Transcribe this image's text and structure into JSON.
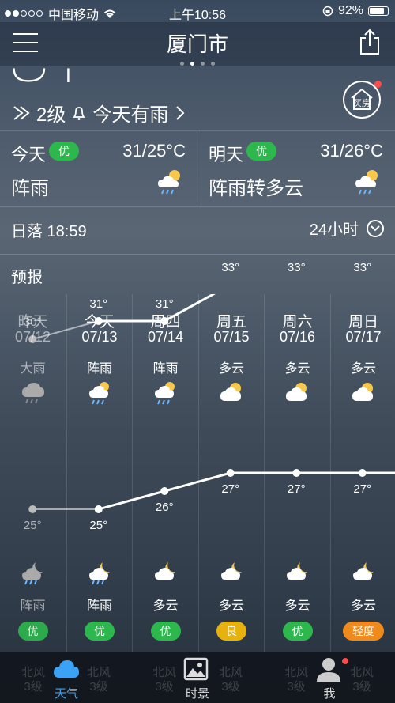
{
  "status_bar": {
    "signal_text": "●●○○○ 中国移动",
    "carrier": "中国移动",
    "time": "上午10:56",
    "battery": "92%"
  },
  "header": {
    "city": "厦门市",
    "page_count": 4,
    "active_page": 1
  },
  "current": {
    "wind": "2级",
    "alert": "今天有雨",
    "house_button": "买房"
  },
  "today": {
    "name": "今天",
    "aqi": "优",
    "temp": "31/25°C",
    "cond": "阵雨"
  },
  "tomorrow": {
    "name": "明天",
    "aqi": "优",
    "temp": "31/26°C",
    "cond": "阵雨转多云"
  },
  "sunset": {
    "label": "日落 18:59",
    "hours_label": "24小时"
  },
  "forecast": {
    "title": "预报",
    "days": [
      {
        "week": "昨天",
        "date": "07/12",
        "day_cond": "大雨",
        "high": "30°",
        "low": "25°",
        "night_cond": "阵雨",
        "aqi": "优",
        "aqi_level": "good"
      },
      {
        "week": "今天",
        "date": "07/13",
        "day_cond": "阵雨",
        "high": "31°",
        "low": "25°",
        "night_cond": "阵雨",
        "aqi": "优",
        "aqi_level": "good"
      },
      {
        "week": "周四",
        "date": "07/14",
        "day_cond": "阵雨",
        "high": "31°",
        "low": "26°",
        "night_cond": "多云",
        "aqi": "优",
        "aqi_level": "good"
      },
      {
        "week": "周五",
        "date": "07/15",
        "day_cond": "多云",
        "high": "33°",
        "low": "27°",
        "night_cond": "多云",
        "aqi": "良",
        "aqi_level": "moderate"
      },
      {
        "week": "周六",
        "date": "07/16",
        "day_cond": "多云",
        "high": "33°",
        "low": "27°",
        "night_cond": "多云",
        "aqi": "优",
        "aqi_level": "good"
      },
      {
        "week": "周日",
        "date": "07/17",
        "day_cond": "多云",
        "high": "33°",
        "low": "27°",
        "night_cond": "多云",
        "aqi": "轻度",
        "aqi_level": "light"
      }
    ]
  },
  "tabbar": {
    "tabs": [
      {
        "label": "天气",
        "active": true
      },
      {
        "label": "时景",
        "active": false
      },
      {
        "label": "我",
        "active": false,
        "notify": true
      }
    ],
    "ghost_wind": "北风",
    "ghost_level": "3级"
  },
  "colors": {
    "good": "#2db84d",
    "moderate": "#e8b20e",
    "light": "#f08a1c",
    "active_tab": "#3aa3f5"
  }
}
